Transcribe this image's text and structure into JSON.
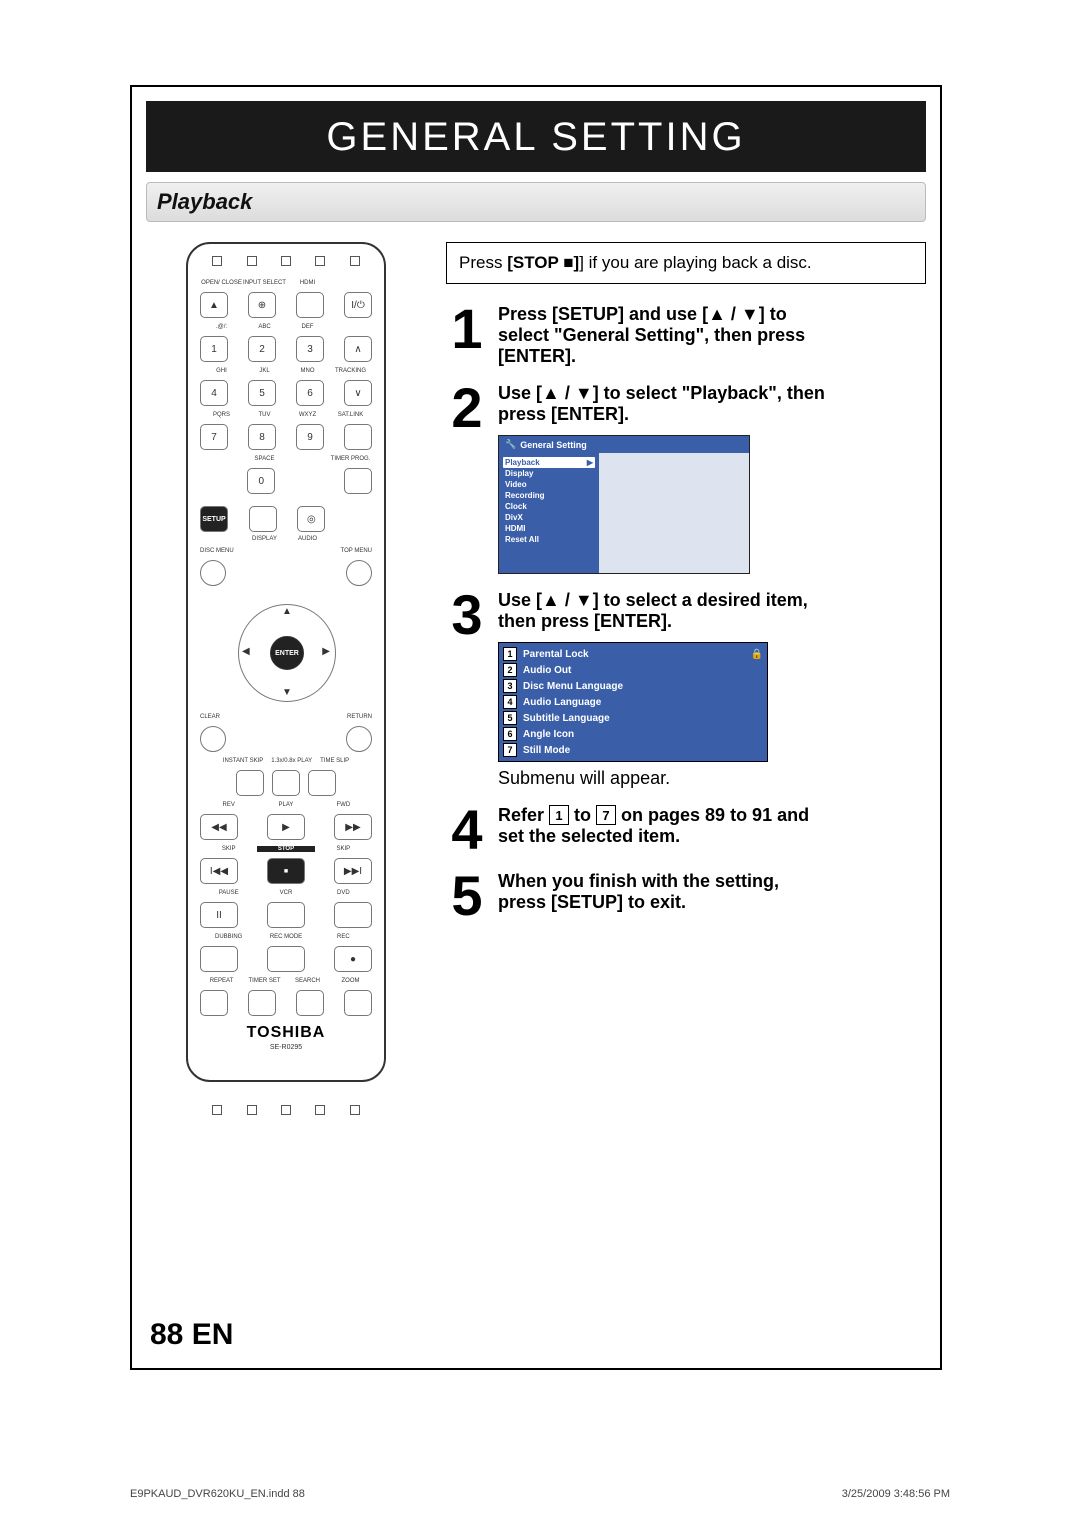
{
  "title": "GENERAL SETTING",
  "section": "Playback",
  "note": {
    "pre": "Press ",
    "key": "[STOP ",
    "icon": "■",
    "post": "] if you are playing back a disc."
  },
  "steps": {
    "s1": {
      "num": "1",
      "line1a": "Press [SETUP] and use [",
      "line1b": " / ",
      "line1c": "] to",
      "line2": "select \"General Setting\", then press",
      "line3": "[ENTER]."
    },
    "s2": {
      "num": "2",
      "line1a": "Use [",
      "line1b": " / ",
      "line1c": "] to select \"Playback\", then",
      "line2": "press [ENTER]."
    },
    "s3": {
      "num": "3",
      "line1a": "Use [",
      "line1b": " / ",
      "line1c": "] to select a desired item,",
      "line2": "then press [ENTER].",
      "submenu_note": "Submenu will appear."
    },
    "s4": {
      "num": "4",
      "pre": "Refer ",
      "n1": "1",
      "mid": " to ",
      "n2": "7",
      "post": " on pages 89 to 91 and",
      "line2": "set the selected item."
    },
    "s5": {
      "num": "5",
      "line1": "When you finish with the setting,",
      "line2": "press [SETUP] to exit."
    }
  },
  "osd": {
    "header": "General Setting",
    "items": [
      "Playback",
      "Display",
      "Video",
      "Recording",
      "Clock",
      "DivX",
      "HDMI",
      "Reset All"
    ]
  },
  "options": [
    {
      "n": "1",
      "label": "Parental Lock",
      "icon": "lock"
    },
    {
      "n": "2",
      "label": "Audio Out"
    },
    {
      "n": "3",
      "label": "Disc Menu Language"
    },
    {
      "n": "4",
      "label": "Audio Language"
    },
    {
      "n": "5",
      "label": "Subtitle Language"
    },
    {
      "n": "6",
      "label": "Angle Icon"
    },
    {
      "n": "7",
      "label": "Still Mode"
    }
  ],
  "remote": {
    "row1": [
      "OPEN/\nCLOSE",
      "INPUT\nSELECT",
      "HDMI",
      ""
    ],
    "numpad_top": [
      ".@/:",
      "ABC",
      "DEF"
    ],
    "numpad_mid": [
      "GHI",
      "JKL",
      "MNO"
    ],
    "numpad_bot": [
      "PQRS",
      "TUV",
      "WXYZ"
    ],
    "nums": [
      "1",
      "2",
      "3",
      "4",
      "5",
      "6",
      "7",
      "8",
      "9",
      "0"
    ],
    "labels": {
      "tracking": "TRACKING",
      "satlink": "SAT.LINK",
      "space": "SPACE",
      "timer": "TIMER\nPROG.",
      "setup": "SETUP",
      "display": "DISPLAY",
      "audio": "AUDIO",
      "discmenu": "DISC MENU",
      "topmenu": "TOP MENU",
      "enter": "ENTER",
      "clear": "CLEAR",
      "return": "RETURN",
      "instant": "INSTANT\nSKIP",
      "playx": "1.3x/0.8x\nPLAY",
      "timeslip": "TIME SLIP",
      "rev": "REV",
      "play": "PLAY",
      "fwd": "FWD",
      "skipL": "SKIP",
      "stop": "STOP",
      "skipR": "SKIP",
      "pause": "PAUSE",
      "vcr": "VCR",
      "dvd": "DVD",
      "dubbing": "DUBBING",
      "recmode": "REC MODE",
      "rec": "REC",
      "repeat": "REPEAT",
      "timerset": "TIMER SET",
      "search": "SEARCH",
      "zoom": "ZOOM"
    },
    "brand": "TOSHIBA",
    "model": "SE-R0295"
  },
  "page_num": "88",
  "page_lang": "EN",
  "footer": {
    "file": "E9PKAUD_DVR620KU_EN.indd   88",
    "date": "3/25/2009   3:48:56 PM"
  }
}
